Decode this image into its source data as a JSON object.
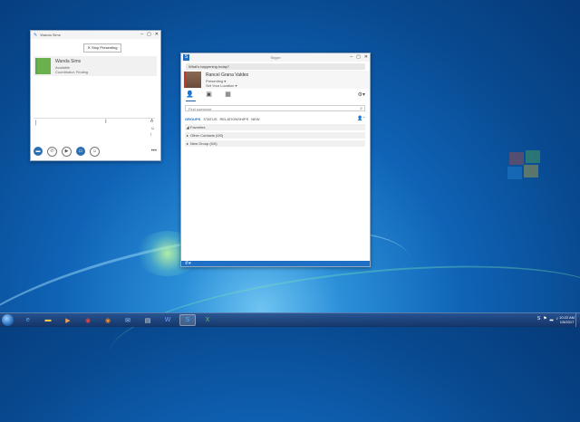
{
  "conversation_window": {
    "title": "Wanda Sims",
    "stop_presenting_label": "Stop Presenting",
    "contact": {
      "name": "Wanda Sims",
      "status": "Available",
      "title_line": "Coordinator, Finding"
    }
  },
  "skype_window": {
    "title": "Skype",
    "status_prompt": "What's happening today?",
    "me": {
      "name": "Rancel Grana Valdes",
      "presence": "Presenting ▾",
      "location": "Set Your Location ▾"
    },
    "search_placeholder": "Find someone",
    "menu": [
      "GROUPS",
      "STATUS",
      "RELATIONSHIPS",
      "NEW"
    ],
    "groups": [
      {
        "arrow": "◢",
        "label": "Favorites"
      },
      {
        "arrow": "▸",
        "label": "Other Contacts (0/0)"
      },
      {
        "arrow": "▸",
        "label": "New Group (0/0)"
      }
    ]
  },
  "taskbar": {
    "clock_time": "10:22 AM",
    "clock_date": "1/5/2017",
    "items": [
      "ie-icon",
      "explorer-icon",
      "media-player-icon",
      "chrome-icon",
      "firefox-icon",
      "outlook-icon",
      "notepad-icon",
      "word-icon",
      "skype-icon",
      "excel-icon"
    ]
  },
  "colors": {
    "accent": "#1f6fc4",
    "presence_available": "#6ab04c",
    "presence_presenting": "#c0392b"
  }
}
